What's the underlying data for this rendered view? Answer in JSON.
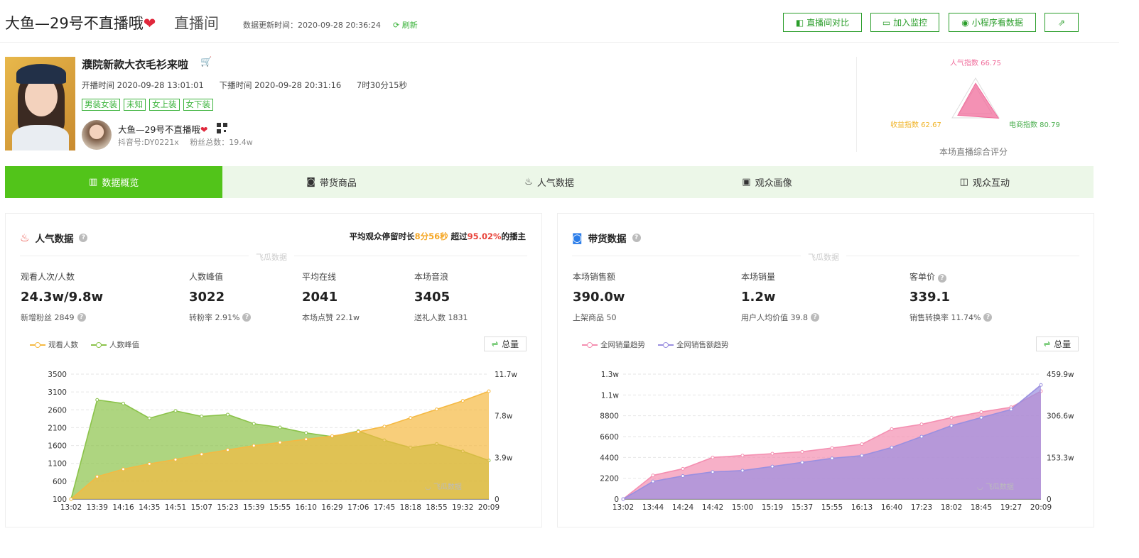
{
  "header": {
    "title": "大鱼—29号不直播哦",
    "title_heart": "❤",
    "subtitle": "直播间",
    "update_time": "数据更新时间：2020-09-28 20:36:24",
    "refresh": "刷新",
    "buttons": [
      {
        "label": "直播间对比",
        "icon": "compare-icon"
      },
      {
        "label": "加入监控",
        "icon": "monitor-icon"
      },
      {
        "label": "小程序看数据",
        "icon": "miniprogram-icon"
      },
      {
        "label": "",
        "icon": "share-icon"
      }
    ]
  },
  "live": {
    "title": "濮院新款大衣毛衫来啦",
    "start": "开播时间 2020-09-28 13:01:01",
    "end": "下播时间 2020-09-28 20:31:16",
    "duration": "7时30分15秒",
    "tags": [
      "男装女装",
      "未知",
      "女上装",
      "女下装"
    ],
    "anchor_name": "大鱼—29号不直播哦",
    "anchor_heart": "❤",
    "douyin_id": "抖音号:DY0221x",
    "fans": "粉丝总数：19.4w"
  },
  "radar": {
    "popularity": "人气指数 66.75",
    "revenue": "收益指数 62.67",
    "ecommerce": "电商指数 80.79",
    "caption": "本场直播综合评分",
    "scores": {
      "popularity": 66.75,
      "revenue": 62.67,
      "ecommerce": 80.79
    },
    "color": "#f06c9b"
  },
  "tabs": [
    {
      "label": "数据概览",
      "icon": "bar-chart-icon",
      "active": true
    },
    {
      "label": "带货商品",
      "icon": "bag-icon",
      "active": false
    },
    {
      "label": "人气数据",
      "icon": "flame-icon",
      "active": false
    },
    {
      "label": "观众画像",
      "icon": "portrait-icon",
      "active": false
    },
    {
      "label": "观众互动",
      "icon": "interaction-icon",
      "active": false
    }
  ],
  "popularity_card": {
    "title": "人气数据",
    "note_pre": "平均观众停留时长",
    "note_time": "8分56秒",
    "note_mid": " 超过",
    "note_pct": "95.02%",
    "note_post": "的播主",
    "watermark": "飞瓜数据",
    "metrics": [
      {
        "label": "观看人次/人数",
        "value": "24.3w/9.8w",
        "sub": "新增粉丝 2849",
        "help": true
      },
      {
        "label": "人数峰值",
        "value": "3022",
        "sub": "转粉率 2.91%",
        "help": true
      },
      {
        "label": "平均在线",
        "value": "2041",
        "sub": "本场点赞 22.1w",
        "help": false
      },
      {
        "label": "本场音浪",
        "value": "3405",
        "sub": "送礼人数 1831",
        "help": false
      }
    ],
    "legend": [
      "观看人数",
      "人数峰值"
    ],
    "total_label": "总量",
    "chart_logo": "飞瓜数据"
  },
  "sales_card": {
    "title": "带货数据",
    "watermark": "飞瓜数据",
    "metrics": [
      {
        "label": "本场销售额",
        "value": "390.0w",
        "sub": "上架商品 50",
        "help": false
      },
      {
        "label": "本场销量",
        "value": "1.2w",
        "sub": "用户人均价值 39.8",
        "help": true
      },
      {
        "label": "客单价",
        "value": "339.1",
        "sub": "销售转换率 11.74%",
        "help": true
      }
    ],
    "legend": [
      "全网销量趋势",
      "全网销售额趋势"
    ],
    "total_label": "总量",
    "chart_logo": "飞瓜数据"
  },
  "chart_data": [
    {
      "type": "area",
      "x": [
        "13:02",
        "13:39",
        "14:16",
        "14:35",
        "14:51",
        "15:07",
        "15:23",
        "15:39",
        "15:55",
        "16:10",
        "16:29",
        "17:06",
        "17:45",
        "18:18",
        "18:55",
        "19:32",
        "20:09"
      ],
      "y_left_ticks": [
        "100",
        "600",
        "1100",
        "1600",
        "2100",
        "2600",
        "3100",
        "3500"
      ],
      "y_right_ticks": [
        "0",
        "3.9w",
        "7.8w",
        "11.7w"
      ],
      "ylim_left": [
        100,
        3500
      ],
      "ylim_right": [
        0,
        117000
      ],
      "series": [
        {
          "name": "观看人数",
          "axis": "right",
          "color": "#f5b942",
          "values": [
            0,
            21000,
            28000,
            33000,
            37000,
            42000,
            46000,
            50000,
            53000,
            56000,
            59000,
            63000,
            68000,
            76000,
            84000,
            92000,
            101000
          ]
        },
        {
          "name": "人数峰值",
          "axis": "left",
          "color": "#8bc34a",
          "values": [
            100,
            2800,
            2700,
            2300,
            2500,
            2350,
            2400,
            2150,
            2050,
            1900,
            1800,
            1950,
            1700,
            1500,
            1600,
            1400,
            1150
          ]
        }
      ]
    },
    {
      "type": "area",
      "x": [
        "13:02",
        "13:44",
        "14:24",
        "14:42",
        "15:00",
        "15:19",
        "15:37",
        "15:55",
        "16:13",
        "16:40",
        "17:23",
        "18:02",
        "18:45",
        "19:27",
        "20:09"
      ],
      "y_left_ticks": [
        "0",
        "2200",
        "4400",
        "6600",
        "8800",
        "1.1w",
        "1.3w"
      ],
      "y_right_ticks": [
        "0",
        "153.3w",
        "306.6w",
        "459.9w"
      ],
      "ylim_left": [
        0,
        13200
      ],
      "ylim_right": [
        0,
        4599000
      ],
      "series": [
        {
          "name": "全网销量趋势",
          "axis": "left",
          "color": "#f48fb1",
          "values": [
            0,
            2500,
            3200,
            4400,
            4600,
            4800,
            5000,
            5400,
            5800,
            7400,
            7900,
            8600,
            9200,
            9700,
            11400
          ]
        },
        {
          "name": "全网销售额趋势",
          "axis": "right",
          "color": "#9a8fe0",
          "values": [
            0,
            650000,
            850000,
            1000000,
            1050000,
            1200000,
            1350000,
            1500000,
            1600000,
            1900000,
            2300000,
            2700000,
            3000000,
            3300000,
            4200000
          ]
        }
      ]
    }
  ]
}
